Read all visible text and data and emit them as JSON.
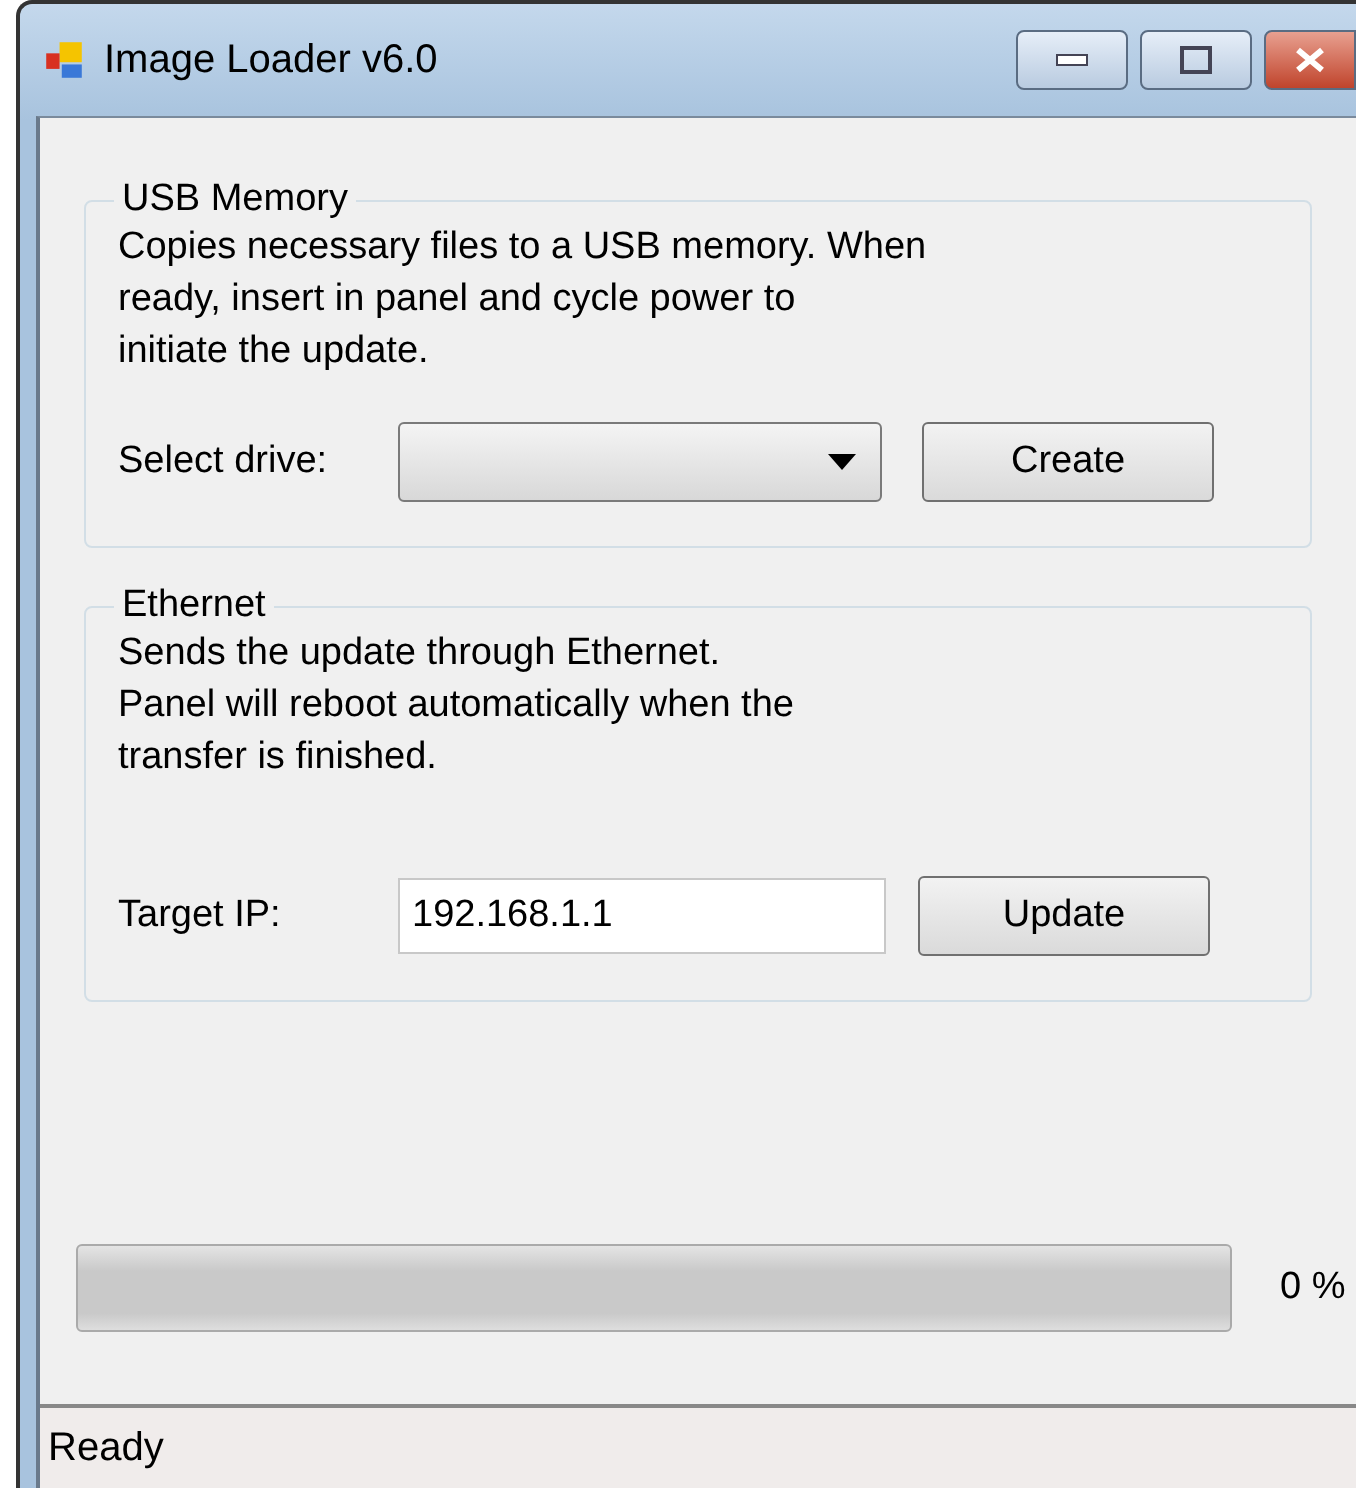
{
  "window": {
    "title": "Image Loader v6.0"
  },
  "groups": [
    {
      "title": "USB Memory",
      "description": "Copies necessary files to a USB memory. When\nready, insert in panel and cycle power to\ninitiate the update.",
      "field_label": "Select drive:",
      "kind": "dropdown",
      "button": "Create"
    },
    {
      "title": "Ethernet",
      "description": "Sends the update through Ethernet.\nPanel will reboot automatically when the\ntransfer is finished.",
      "field_label": "Target IP:",
      "kind": "text",
      "value": "192.168.1.1",
      "button": "Update"
    }
  ],
  "progress": {
    "level": 0,
    "reading": "0 %"
  },
  "status_bar": "Ready"
}
